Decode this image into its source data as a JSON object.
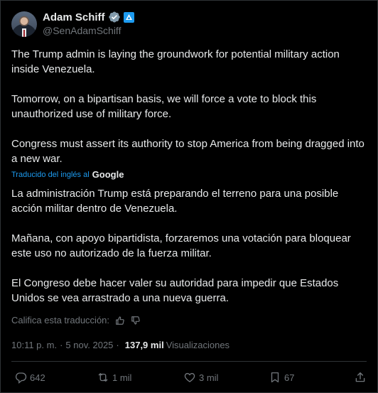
{
  "author": {
    "display_name": "Adam Schiff",
    "handle": "@SenAdamSchiff"
  },
  "tweet": {
    "paragraphs": [
      "The Trump admin is laying the groundwork for potential military action inside Venezuela.",
      "Tomorrow, on a bipartisan basis, we will force a vote to block this unauthorized use of military force.",
      "Congress must assert its authority to stop America from being dragged into a new war."
    ]
  },
  "translation": {
    "credit_label": "Traducido del inglés al",
    "provider": "Google",
    "paragraphs": [
      "La administración Trump está preparando el terreno para una posible acción militar dentro de Venezuela.",
      "Mañana, con apoyo bipartidista, forzaremos una votación para bloquear este uso no autorizado de la fuerza militar.",
      "El Congreso debe hacer valer su autoridad para impedir que Estados Unidos se vea arrastrado a una nueva guerra."
    ],
    "rate_label": "Califica esta traducción:"
  },
  "meta": {
    "time": "10:11 p. m.",
    "separator": "·",
    "date": "5 nov. 2025",
    "views_count": "137,9 mil",
    "views_label": "Visualizaciones"
  },
  "actions": {
    "replies": "642",
    "reposts": "1 mil",
    "likes": "3 mil",
    "bookmarks": "67"
  },
  "colors": {
    "background": "#000000",
    "text": "#e7e9ea",
    "secondary": "#71767b",
    "accent": "#1d9bf0",
    "divider": "#2f3336"
  },
  "icons": [
    "verified-badge-icon",
    "government-badge-icon",
    "thumbs-up-icon",
    "thumbs-down-icon",
    "reply-icon",
    "repost-icon",
    "like-icon",
    "bookmark-icon",
    "share-icon"
  ]
}
